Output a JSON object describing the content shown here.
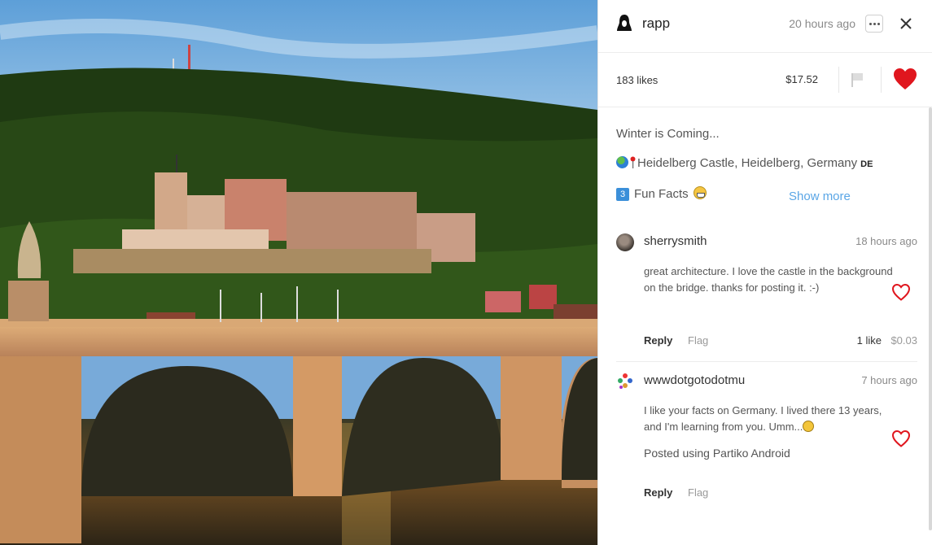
{
  "post": {
    "author": "rapp",
    "time": "20 hours ago",
    "likes": "183 likes",
    "payout": "$17.52",
    "title": "Winter is Coming...",
    "location": "Heidelberg Castle, Heidelberg, Germany",
    "location_flag": "DE",
    "fun_facts_num": "3",
    "fun_facts": "Fun Facts",
    "show_more": "Show more",
    "liked": true,
    "heart_color": "#e0161e"
  },
  "comments": [
    {
      "author": "sherrysmith",
      "time": "18 hours ago",
      "text": "great architecture. I love the castle in the background on the bridge. thanks for posting it. :-)",
      "reply": "Reply",
      "flag": "Flag",
      "likes": "1 like",
      "payout": "$0.03"
    },
    {
      "author": "wwwdotgotodotmu",
      "time": "7 hours ago",
      "text": "I like your facts on Germany. I lived there 13 years, and I'm learning from you. Umm...",
      "footer": "Posted using Partiko Android",
      "reply": "Reply",
      "flag": "Flag"
    }
  ],
  "icons": {
    "more": "more-icon",
    "close": "close-icon",
    "flag": "flag-icon",
    "heart": "heart-icon"
  }
}
